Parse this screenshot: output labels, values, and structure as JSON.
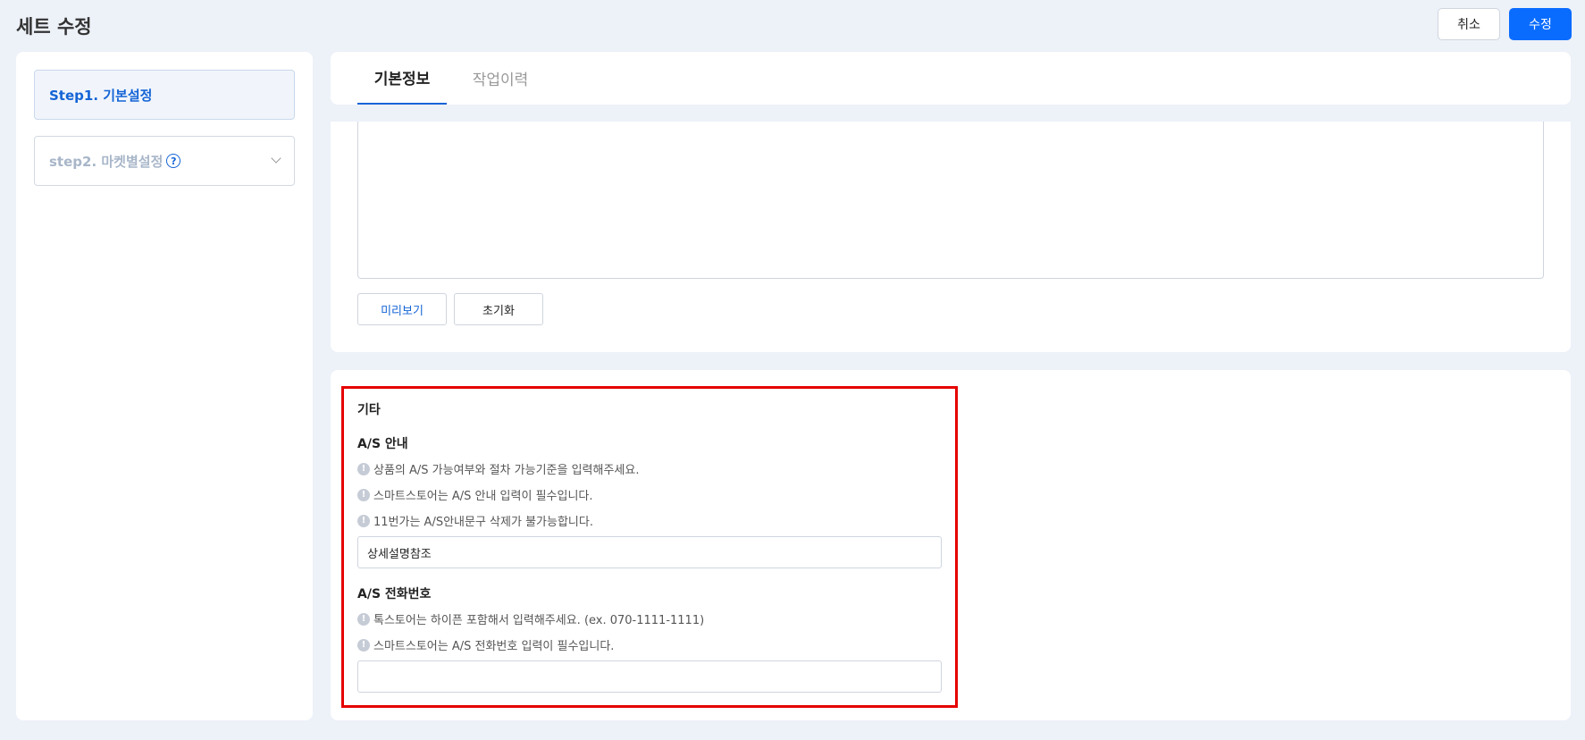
{
  "header": {
    "title": "세트 수정",
    "cancel_label": "취소",
    "save_label": "수정"
  },
  "sidebar": {
    "steps": [
      {
        "label": "Step1. 기본설정",
        "active": true
      },
      {
        "label": "step2. 마켓별설정",
        "active": false,
        "help_icon": "question-icon",
        "chevron_icon": "chevron-down-icon"
      }
    ]
  },
  "tabs": [
    {
      "label": "기본정보",
      "active": true
    },
    {
      "label": "작업이력",
      "active": false
    }
  ],
  "editor": {
    "preview_label": "미리보기",
    "reset_label": "초기화"
  },
  "misc": {
    "section_title": "기타",
    "as_guide": {
      "label": "A/S 안내",
      "notes": [
        "상품의 A/S 가능여부와 절차 가능기준을 입력해주세요.",
        "스마트스토어는 A/S 안내 입력이 필수입니다.",
        "11번가는 A/S안내문구 삭제가 불가능합니다."
      ],
      "value": "상세설명참조"
    },
    "as_phone": {
      "label": "A/S 전화번호",
      "notes": [
        "톡스토어는 하이픈 포함해서 입력해주세요. (ex. 070-1111-1111)",
        "스마트스토어는 A/S 전화번호 입력이 필수입니다."
      ],
      "value": ""
    }
  },
  "colors": {
    "accent": "#0a6cff",
    "highlight": "#e60000",
    "background": "#edf1f8"
  }
}
